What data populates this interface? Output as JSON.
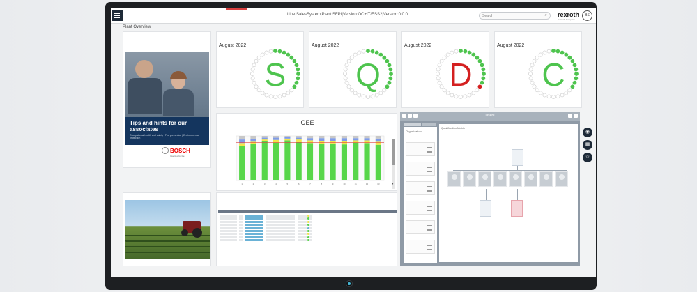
{
  "header": {
    "breadcrumb": "Line:SalesSystem|Plant:SFPI|Version:OC+IT/ESS2|Version:0.0.0",
    "search_placeholder": "Search",
    "logo": "rexroth",
    "logo_sub": "A Bosch Company",
    "user_initials": "BS"
  },
  "page": {
    "title": "Plant Overview"
  },
  "promo": {
    "headline_line1": "Tips and hints for our",
    "headline_line2": "associates",
    "subline": "Occupational health and safety | Fire prevention | Environmental protection",
    "brand": "BOSCH",
    "brand_sub": "Invented for life"
  },
  "sqdc": [
    {
      "month": "August 2022",
      "letter": "S",
      "color": "#4ec44e",
      "filled": 12,
      "total": 32,
      "alert": false
    },
    {
      "month": "August 2022",
      "letter": "Q",
      "color": "#4ec44e",
      "filled": 12,
      "total": 32,
      "alert": false
    },
    {
      "month": "August 2022",
      "letter": "D",
      "color": "#d42020",
      "filled": 12,
      "total": 32,
      "alert": true
    },
    {
      "month": "August 2022",
      "letter": "C",
      "color": "#4ec44e",
      "filled": 12,
      "total": 32,
      "alert": false
    }
  ],
  "oee": {
    "title": "OEE"
  },
  "chart_data": {
    "type": "bar",
    "title": "OEE",
    "categories": [
      "1",
      "2",
      "3",
      "4",
      "5",
      "6",
      "7",
      "8",
      "9",
      "10",
      "11",
      "12",
      "13"
    ],
    "series": [
      {
        "values": [
          78,
          82,
          88,
          85,
          90,
          86,
          84,
          82,
          83,
          81,
          85,
          84,
          80
        ]
      },
      {
        "values": [
          6,
          5,
          4,
          6,
          4,
          6,
          6,
          7,
          6,
          7,
          5,
          6,
          7
        ]
      },
      {
        "values": [
          8,
          6,
          4,
          5,
          3,
          4,
          5,
          6,
          6,
          7,
          5,
          5,
          7
        ]
      },
      {
        "values": [
          8,
          7,
          4,
          4,
          3,
          4,
          5,
          5,
          5,
          5,
          5,
          5,
          6
        ]
      }
    ],
    "colors": [
      "#58d64a",
      "#f2e54a",
      "#7f9be8",
      "#c8c8c8"
    ],
    "target_line": 85,
    "ylim": [
      0,
      100
    ]
  },
  "org": {
    "title": "Users",
    "left_title": "Organization",
    "main_title": "Qualification Matrix",
    "left_items": [
      "",
      "",
      "",
      "",
      "",
      ""
    ],
    "avatars": 8
  },
  "side_buttons": [
    "eye-icon",
    "grid-icon",
    "star-icon"
  ]
}
